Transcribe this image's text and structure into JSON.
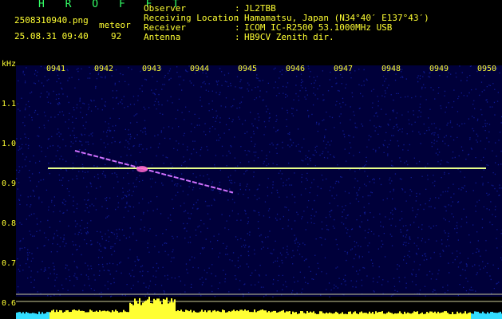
{
  "header": {
    "app_title": "H R O F F T",
    "file_name": "2508310940.png",
    "date_time": "25.08.31 09:40",
    "mode_label": "meteor",
    "count": "92",
    "info": [
      {
        "label": "Observer",
        "sep": ":",
        "value": "JL2TBB"
      },
      {
        "label": "Receiving Location",
        "sep": ":",
        "value": "Hamamatsu, Japan (N34°40′ E137°43′)"
      },
      {
        "label": "Receiver",
        "sep": ":",
        "value": "ICOM IC-R2500 53.1000MHz USB"
      },
      {
        "label": "Antenna",
        "sep": ":",
        "value": "HB9CV Zenith dir."
      }
    ]
  },
  "spectrogram": {
    "y_unit": "kHz",
    "colors": {
      "text": "#ffff33",
      "green_text": "#33ff66",
      "background": "#00003a",
      "carrier": "#e8ff8a",
      "echo": "#d070ff",
      "bar_yellow": "#ffff33",
      "bar_cyan": "#33ddff",
      "baseline": "#cccc99"
    },
    "x_ticks": [
      "0941",
      "0942",
      "0943",
      "0944",
      "0945",
      "0946",
      "0947",
      "0948",
      "0949",
      "0950"
    ],
    "y_ticks": [
      "1.1",
      "1.0",
      "0.9",
      "0.8",
      "0.7",
      "0.6"
    ]
  },
  "chart_data": {
    "type": "heatmap",
    "x_ticks": [
      "0941",
      "0942",
      "0943",
      "0944",
      "0945",
      "0946",
      "0947",
      "0948",
      "0949",
      "0950"
    ],
    "y_ticks_khz": [
      1.1,
      1.0,
      0.9,
      0.8,
      0.7,
      0.6
    ],
    "ylabel": "kHz",
    "carrier_khz": 0.936,
    "meteor_echo": {
      "start_time": "0941.4",
      "end_time": "0944.7",
      "start_khz": 0.98,
      "end_khz": 0.875
    }
  }
}
